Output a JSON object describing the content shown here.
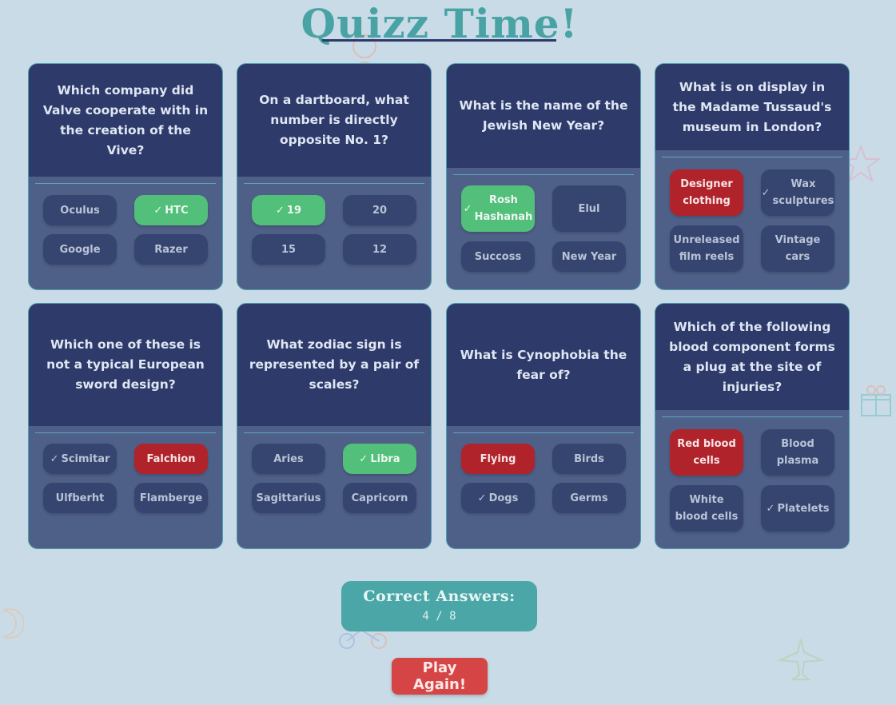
{
  "title": "Quizz Time!",
  "cards": [
    {
      "question": "Which company did Valve cooperate with in the creation of the Vive?",
      "options": [
        {
          "label": "Oculus",
          "state": "none"
        },
        {
          "label": "HTC",
          "state": "correct"
        },
        {
          "label": "Google",
          "state": "none"
        },
        {
          "label": "Razer",
          "state": "none"
        }
      ]
    },
    {
      "question": "On a dartboard, what number is directly opposite No. 1?",
      "options": [
        {
          "label": "19",
          "state": "correct"
        },
        {
          "label": "20",
          "state": "none"
        },
        {
          "label": "15",
          "state": "none"
        },
        {
          "label": "12",
          "state": "none"
        }
      ]
    },
    {
      "question": "What is the name of the Jewish New Year?",
      "options": [
        {
          "label": "Rosh Hashanah",
          "state": "correct"
        },
        {
          "label": "Elul",
          "state": "none"
        },
        {
          "label": "Succoss",
          "state": "none"
        },
        {
          "label": "New Year",
          "state": "none"
        }
      ]
    },
    {
      "question": "What is on display in the Madame Tussaud's museum in London?",
      "options": [
        {
          "label": "Designer clothing",
          "state": "wrong"
        },
        {
          "label": "Wax sculptures",
          "state": "answer"
        },
        {
          "label": "Unreleased film reels",
          "state": "none"
        },
        {
          "label": "Vintage cars",
          "state": "none"
        }
      ]
    },
    {
      "question": "Which one of these is not a typical European sword design?",
      "options": [
        {
          "label": "Scimitar",
          "state": "answer"
        },
        {
          "label": "Falchion",
          "state": "wrong"
        },
        {
          "label": "Ulfberht",
          "state": "none"
        },
        {
          "label": "Flamberge",
          "state": "none"
        }
      ]
    },
    {
      "question": "What zodiac sign is represented by a pair of scales?",
      "options": [
        {
          "label": "Aries",
          "state": "none"
        },
        {
          "label": "Libra",
          "state": "correct"
        },
        {
          "label": "Sagittarius",
          "state": "none"
        },
        {
          "label": "Capricorn",
          "state": "none"
        }
      ]
    },
    {
      "question": "What is Cynophobia the fear of?",
      "options": [
        {
          "label": "Flying",
          "state": "wrong"
        },
        {
          "label": "Birds",
          "state": "none"
        },
        {
          "label": "Dogs",
          "state": "answer"
        },
        {
          "label": "Germs",
          "state": "none"
        }
      ]
    },
    {
      "question": "Which of the following blood component forms a plug at the site of injuries?",
      "options": [
        {
          "label": "Red blood cells",
          "state": "wrong"
        },
        {
          "label": "Blood plasma",
          "state": "none"
        },
        {
          "label": "White blood cells",
          "state": "none"
        },
        {
          "label": "Platelets",
          "state": "answer"
        }
      ]
    }
  ],
  "check_mark": "✓",
  "score": {
    "title": "Correct Answers:",
    "value": "4 / 8"
  },
  "play_again": "Play Again!",
  "colors": {
    "background": "#c9dbe6",
    "card_header": "#2d3a6a",
    "card_body": "#4f6088",
    "correct": "#52bf7b",
    "wrong": "#b0232a",
    "accent": "#49a3a5",
    "play_button": "#d64545"
  }
}
